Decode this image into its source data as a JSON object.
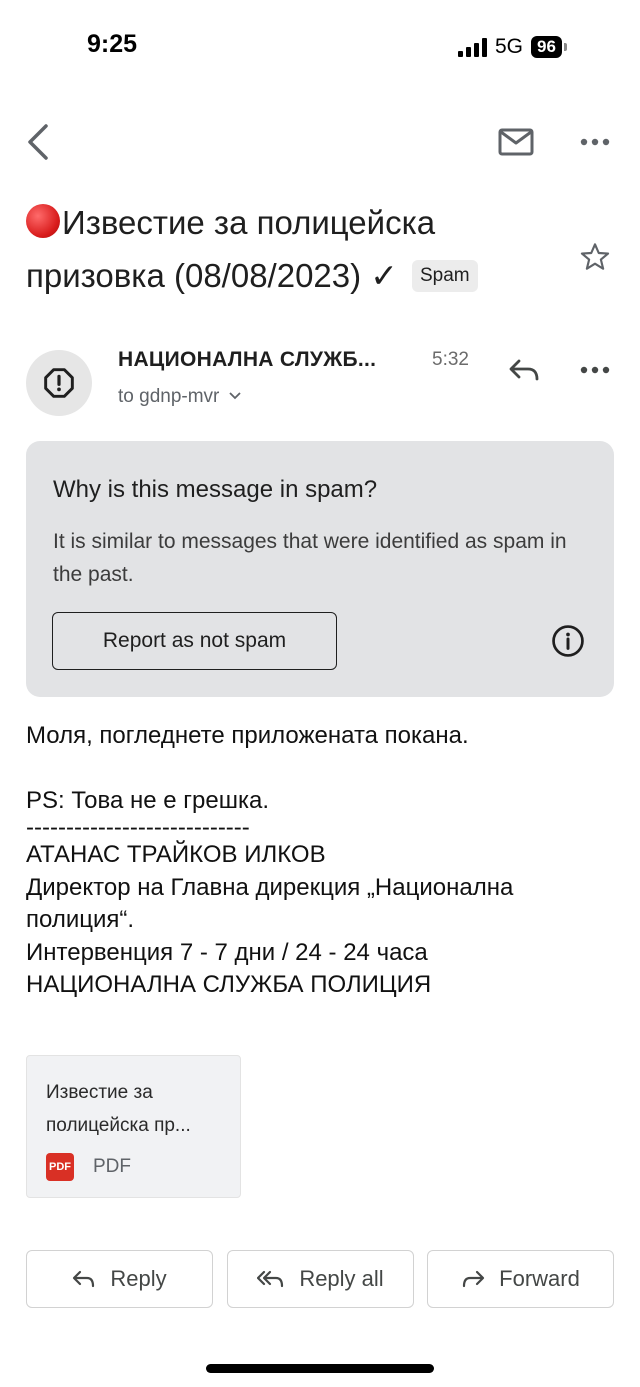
{
  "status_bar": {
    "time": "9:25",
    "network": "5G",
    "battery": "96"
  },
  "subject": {
    "text": "Известие за полицейска призовка (08/08/2023) ✓",
    "label_chip": "Spam"
  },
  "sender": {
    "name": "НАЦИОНАЛНА СЛУЖБ...",
    "time": "5:32",
    "to": "to gdnp-mvr"
  },
  "spam_notice": {
    "title": "Why is this message in spam?",
    "description": "It is similar to messages that were identified as spam in the past.",
    "button_label": "Report as not spam"
  },
  "body": {
    "line1": "Моля, погледнете приложената покана.",
    "line2": "PS: Това не е грешка.",
    "line3": "----------------------------",
    "line4": "АТАНАС ТРАЙКОВ ИЛКОВ",
    "line5": "Директор на Главна дирекция „Национална полиция“.",
    "line6": "Интервенция 7 - 7 дни / 24 - 24 часа",
    "line7": "НАЦИОНАЛНА СЛУЖБА ПОЛИЦИЯ"
  },
  "attachment": {
    "name": "Известие за полицейска пр...",
    "type": "PDF",
    "badge": "PDF"
  },
  "actions": {
    "reply": "Reply",
    "reply_all": "Reply all",
    "forward": "Forward"
  },
  "colors": {
    "spam_card_bg": "#e2e3e5",
    "pdf_badge": "#d93025",
    "red_dot": "#d81b1b"
  }
}
